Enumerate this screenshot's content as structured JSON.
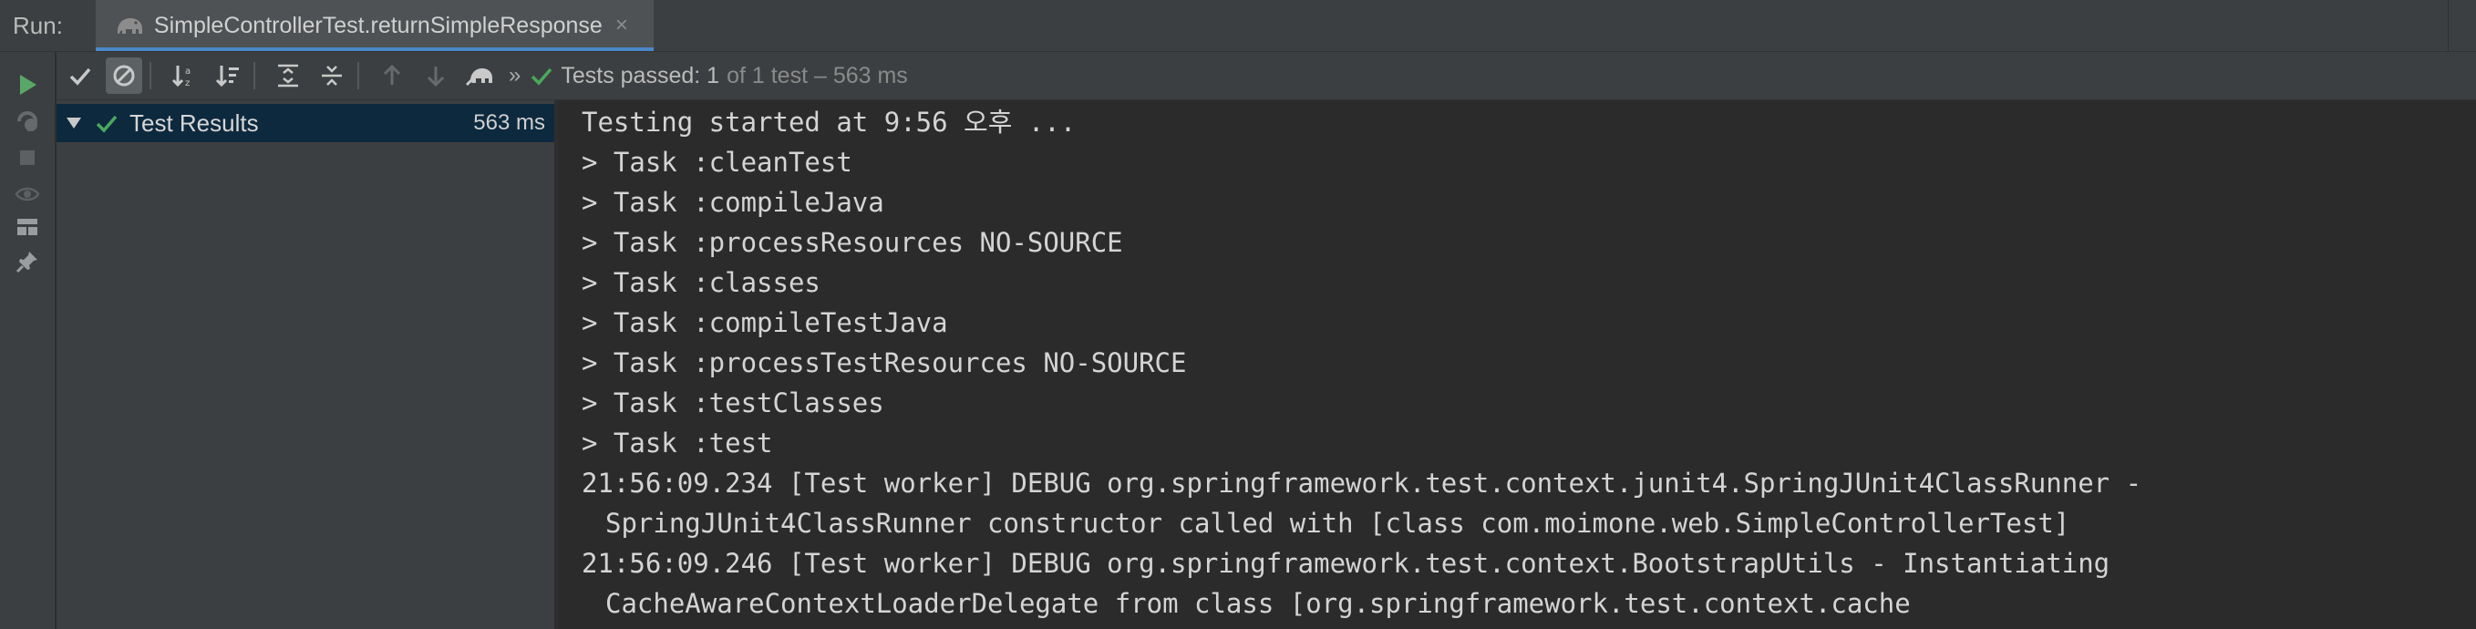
{
  "tabbar": {
    "run_label": "Run:",
    "tab_title": "SimpleControllerTest.returnSimpleResponse",
    "tab_close": "×"
  },
  "toolbar": {
    "status_text": "Tests passed: 1",
    "status_count": "of 1 test – 563 ms",
    "more": "»"
  },
  "tree": {
    "root_label": "Test Results",
    "root_time": "563 ms"
  },
  "console": {
    "lines": [
      "Testing started at 9:56 오후 ...",
      "> Task :cleanTest",
      "> Task :compileJava",
      "> Task :processResources NO-SOURCE",
      "> Task :classes",
      "> Task :compileTestJava",
      "> Task :processTestResources NO-SOURCE",
      "> Task :testClasses",
      "> Task :test",
      "21:56:09.234 [Test worker] DEBUG org.springframework.test.context.junit4.SpringJUnit4ClassRunner -",
      "SpringJUnit4ClassRunner constructor called with [class com.moimone.web.SimpleControllerTest]",
      "21:56:09.246 [Test worker] DEBUG org.springframework.test.context.BootstrapUtils - Instantiating",
      "CacheAwareContextLoaderDelegate from class [org.springframework.test.context.cache"
    ]
  },
  "colors": {
    "background": "#2b2b2b",
    "panel": "#3c3f41",
    "selection": "#0d293e",
    "success": "#4aa85b",
    "run_green": "#59a869",
    "accent": "#4a88c7"
  },
  "icons": {
    "run": "play-icon",
    "rerun_failed": "rerun-failed-icon",
    "stop": "stop-icon",
    "show_options": "eye-icon",
    "layout": "layout-icon",
    "pin": "pin-icon",
    "show_passed": "check-icon",
    "show_ignored": "ignored-icon",
    "sort_alpha": "sort-alphabetically-icon",
    "sort_duration": "sort-duration-icon",
    "expand_all": "expand-all-icon",
    "collapse_all": "collapse-all-icon",
    "prev_failed": "arrow-up-icon",
    "next_failed": "arrow-down-icon",
    "import_tests": "import-tests-icon"
  }
}
